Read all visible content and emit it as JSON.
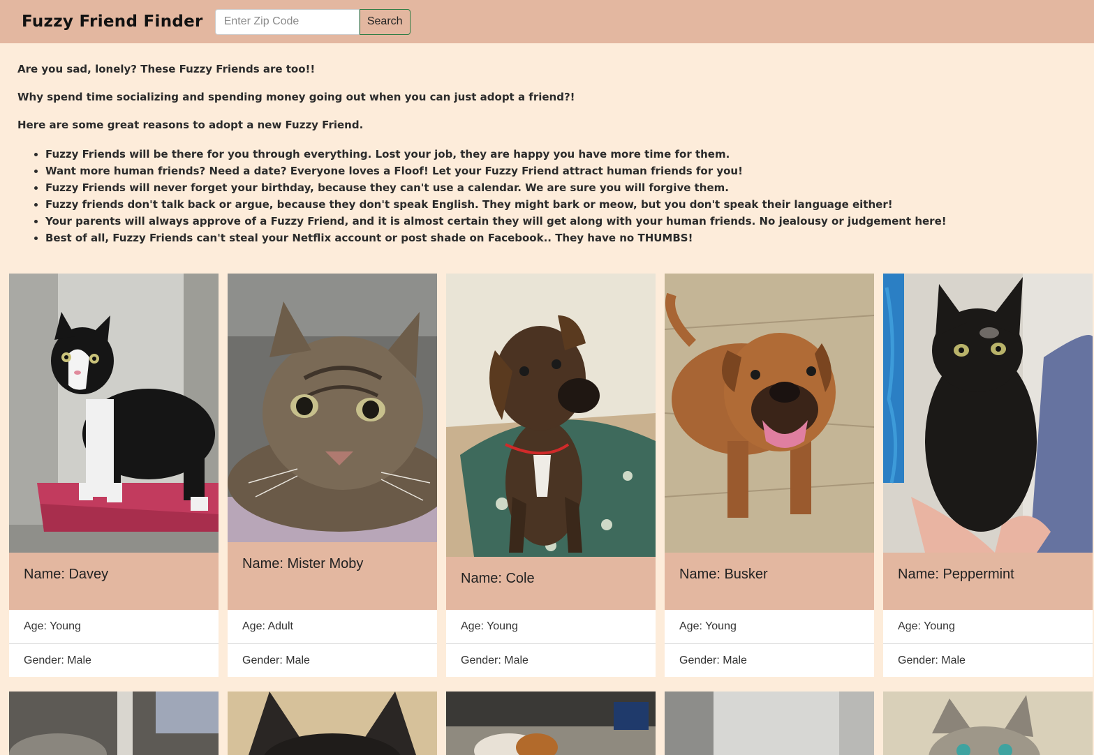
{
  "navbar": {
    "brand": "Fuzzy Friend Finder",
    "zip_placeholder": "Enter Zip Code",
    "search_label": "Search"
  },
  "intro": {
    "line1": "Are you sad, lonely? These Fuzzy Friends are too!!",
    "line2": "Why spend time socializing and spending money going out when you can just adopt a friend?!",
    "line3": "Here are some great reasons to adopt a new Fuzzy Friend.",
    "reasons": [
      "Fuzzy Friends will be there for you through everything. Lost your job, they are happy you have more time for them.",
      "Want more human friends? Need a date? Everyone loves a Floof! Let your Fuzzy Friend attract human friends for you!",
      "Fuzzy Friends will never forget your birthday, because they can't use a calendar. We are sure you will forgive them.",
      "Fuzzy friends don't talk back or argue, because they don't speak English. They might bark or meow, but you don't speak their language either!",
      "Your parents will always approve of a Fuzzy Friend, and it is almost certain they will get along with your human friends. No jealousy or judgement here!",
      "Best of all, Fuzzy Friends can't steal your Netflix account or post shade on Facebook.. They have no THUMBS!"
    ]
  },
  "pets": [
    {
      "name": "Name: Davey",
      "age": "Age: Young",
      "gender": "Gender: Male",
      "photo": "tuxedo-cat-photo"
    },
    {
      "name": "Name: Mister Moby",
      "age": "Age: Adult",
      "gender": "Gender: Male",
      "photo": "tabby-cat-photo"
    },
    {
      "name": "Name: Cole",
      "age": "Age: Young",
      "gender": "Gender: Male",
      "photo": "brown-dog-photo"
    },
    {
      "name": "Name: Busker",
      "age": "Age: Young",
      "gender": "Gender: Male",
      "photo": "smiling-dog-photo"
    },
    {
      "name": "Name: Peppermint",
      "age": "Age: Young",
      "gender": "Gender: Male",
      "photo": "black-cat-photo"
    }
  ],
  "colors": {
    "navbar": "#e3b7a0",
    "background": "#fdecda",
    "button_border": "#2f7d45"
  }
}
